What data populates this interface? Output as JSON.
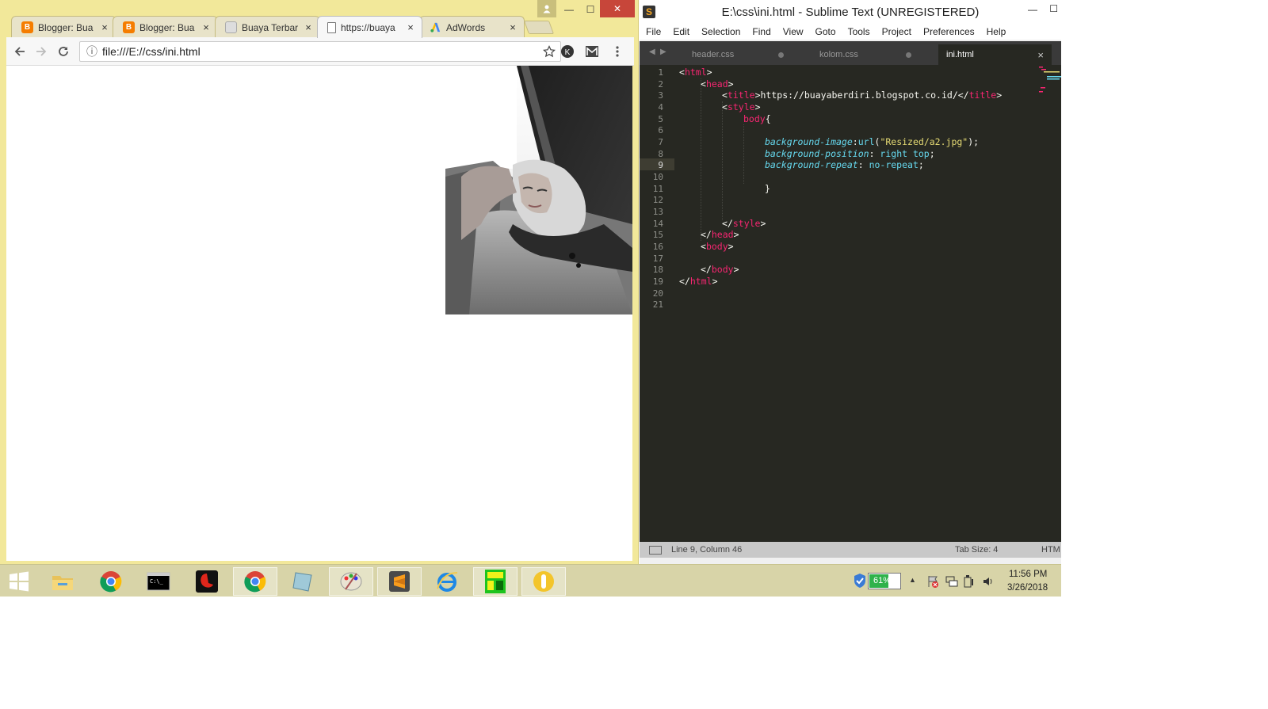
{
  "chrome": {
    "tabs": [
      {
        "title": "Blogger: Bua",
        "icon": "blogger-icon",
        "color": "#f57d00"
      },
      {
        "title": "Blogger: Bua",
        "icon": "blogger-icon",
        "color": "#f57d00"
      },
      {
        "title": "Buaya Terbar",
        "icon": "page-thumbnail-icon",
        "color": "#999999"
      },
      {
        "title": "https://buaya",
        "icon": "document-icon",
        "color": "#777777",
        "active": true
      },
      {
        "title": "AdWords",
        "icon": "adwords-icon",
        "color": "#4285f4"
      }
    ],
    "close_glyph": "×",
    "url": "file:///E://css/ini.html",
    "url_icon": "ⓘ",
    "window_buttons": {
      "minimize": "—",
      "maximize": "☐",
      "close": "✕"
    }
  },
  "sublime": {
    "title": "E:\\css\\ini.html - Sublime Text (UNREGISTERED)",
    "menu": [
      "File",
      "Edit",
      "Selection",
      "Find",
      "View",
      "Goto",
      "Tools",
      "Project",
      "Preferences",
      "Help"
    ],
    "tabs": [
      {
        "label": "header.css",
        "dirty": true
      },
      {
        "label": "kolom.css",
        "dirty": true
      },
      {
        "label": "ini.html",
        "active": true
      }
    ],
    "line_numbers": [
      "1",
      "2",
      "3",
      "4",
      "5",
      "6",
      "7",
      "8",
      "9",
      "10",
      "11",
      "12",
      "13",
      "14",
      "15",
      "16",
      "17",
      "18",
      "19",
      "20",
      "21"
    ],
    "code": {
      "l1_open": "<",
      "l1_tag": "html",
      "l1_close": ">",
      "l2_tag": "head",
      "l3_tag": "title",
      "l3_text": "https://buayaberdiri.blogspot.co.id/",
      "l3_tag2": "title",
      "l4_tag": "style",
      "l5_sel": "body",
      "l5_brace": "{",
      "l7_prop": "background-image",
      "l7_fn": "url",
      "l7_str": "\"Resized/a2.jpg\"",
      "l7_end": ");",
      "l8_prop": "background-position",
      "l8_val": "right top",
      "l8_end": ";",
      "l9_prop": "background-repeat",
      "l9_val": "no-repeat",
      "l9_end": ";",
      "l11_brace": "}",
      "l14_tag": "style",
      "l15_tag": "head",
      "l16_tag": "body",
      "l18_tag": "body",
      "l19_tag": "html"
    },
    "status": {
      "position": "Line 9, Column 46",
      "tab_size": "Tab Size: 4",
      "syntax": "HTM"
    }
  },
  "taskbar": {
    "apps": [
      "start-icon",
      "file-explorer-icon",
      "chrome-icon",
      "command-prompt-icon",
      "garena-icon",
      "chrome-icon",
      "paper-icon",
      "paint-icon",
      "sublime-icon",
      "internet-explorer-icon",
      "green-app-icon",
      "yellow-app-icon"
    ],
    "battery": "61%",
    "time": "11:56 PM",
    "date": "3/26/2018"
  }
}
